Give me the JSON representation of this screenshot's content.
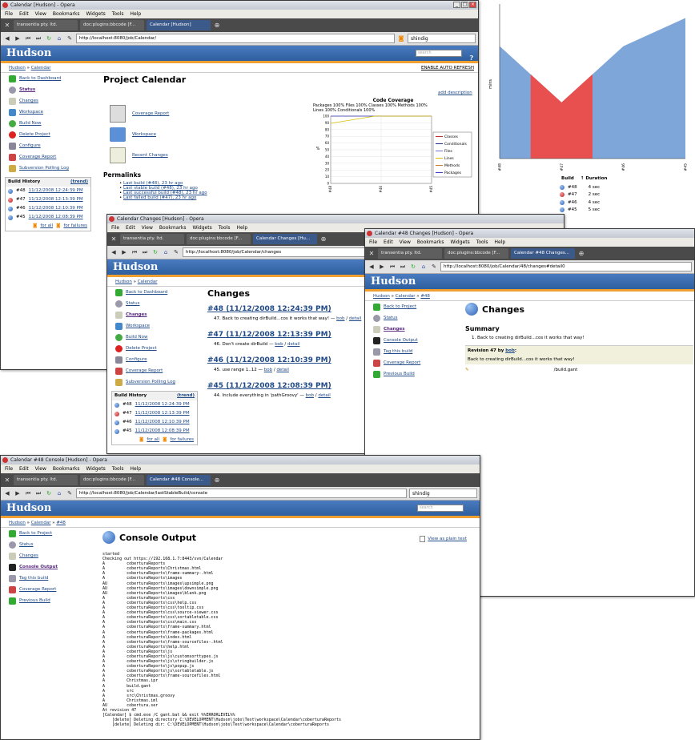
{
  "browser": {
    "menu": [
      "File",
      "Edit",
      "View",
      "Bookmarks",
      "Widgets",
      "Tools",
      "Help"
    ],
    "tab1": "transentia pty. ltd.",
    "tab2": "doc:plugins:bbcode [F...",
    "search": "shindig"
  },
  "hudson": {
    "logo": "Hudson",
    "search_placeholder": "search"
  },
  "w1": {
    "title": "Calendar [Hudson] - Opera",
    "tab": "Calendar [Hudson]",
    "url": "http://localhost:8080/job/Calendar/",
    "bc1": "Hudson",
    "bc2": "Calendar",
    "auto": "ENABLE AUTO REFRESH",
    "side": [
      "Back to Dashboard",
      "Status",
      "Changes",
      "Workspace",
      "Build Now",
      "Delete Project",
      "Configure",
      "Coverage Report",
      "Subversion Polling Log"
    ],
    "history": {
      "title": "Build History",
      "trend": "(trend)",
      "rows": [
        {
          "n": "#48",
          "d": "11/12/2008 12:24:39 PM"
        },
        {
          "n": "#47",
          "d": "11/12/2008 12:13:39 PM"
        },
        {
          "n": "#46",
          "d": "11/12/2008 12:10:39 PM"
        },
        {
          "n": "#45",
          "d": "11/12/2008 12:08:39 PM"
        }
      ],
      "all": "for all",
      "fail": "for failures"
    },
    "heading": "Project Calendar",
    "add_desc": "add description",
    "links": [
      "Coverage Report",
      "Workspace",
      "Recent Changes"
    ],
    "perma": {
      "title": "Permalinks",
      "items": [
        "Last build (#48), 23 hr ago",
        "Last stable build (#48), 23 hr ago",
        "Last successful build (#48), 23 hr ago",
        "Last failed build (#47), 23 hr ago"
      ]
    }
  },
  "cov": {
    "title": "Code Coverage",
    "l1": "Packages  100% Files  100% Classes  100% Methods  100%",
    "l2": "Lines  100% Conditionals  100%",
    "legend": [
      "Classes",
      "Conditionals",
      "Files",
      "Lines",
      "Methods",
      "Packages"
    ],
    "legend_colors": [
      "#c03030",
      "#203080",
      "#7070d0",
      "#d8c000",
      "#c08030",
      "#4040c0"
    ],
    "yticks": [
      "100",
      "90",
      "80",
      "70",
      "60",
      "50",
      "40",
      "30",
      "20",
      "10",
      "0"
    ],
    "xticks": [
      "#48",
      "#46",
      "#45"
    ],
    "ylabel": "%"
  },
  "chart_data": {
    "type": "area",
    "x": [
      "#48",
      "#47",
      "#46",
      "#45"
    ],
    "series": [
      {
        "values": [
          4,
          2,
          4,
          5
        ]
      }
    ],
    "ylabel": "mins",
    "colors": [
      "#7ea6d8",
      "#e85050"
    ]
  },
  "durations": {
    "h1": "Build",
    "h2": "↑ Duration",
    "rows": [
      {
        "n": "#48",
        "d": "4 sec"
      },
      {
        "n": "#47",
        "d": "2 sec"
      },
      {
        "n": "#46",
        "d": "4 sec"
      },
      {
        "n": "#45",
        "d": "5 sec"
      }
    ]
  },
  "w2": {
    "title": "Calendar Changes [Hudson] - Opera",
    "tab": "Calendar Changes [Hu...",
    "url": "http://localhost:8080/job/Calendar/changes",
    "heading": "Changes",
    "entries": [
      {
        "h": "#48 (11/12/2008 12:24:39 PM)",
        "t": "47. Back to creating dirBuild...cos it works that way! —",
        "u": "bob",
        "d": "detail"
      },
      {
        "h": "#47 (11/12/2008 12:13:39 PM)",
        "t": "46. Don't create dirBuild —",
        "u": "bob",
        "d": "detail"
      },
      {
        "h": "#46 (11/12/2008 12:10:39 PM)",
        "t": "45. use range 1..12 —",
        "u": "bob",
        "d": "detail"
      },
      {
        "h": "#45 (11/12/2008 12:08:39 PM)",
        "t": "44. Include everything in 'pathGroovy' —",
        "u": "bob",
        "d": "detail"
      }
    ]
  },
  "w3": {
    "title": "Calendar #48 Changes [Hudson] - Opera",
    "tab": "Calendar #48 Changes...",
    "url": "http://localhost:8080/job/Calendar/48/changes#detail0",
    "bc3": "#48",
    "side": [
      "Back to Project",
      "Status",
      "Changes",
      "Console Output",
      "Tag this build",
      "Coverage Report",
      "Previous Build"
    ],
    "heading": "Changes",
    "summary": "Summary",
    "item": "1.  Back to creating dirBuild...cos it works that way!",
    "rev": "Revision 47 by",
    "rev_user": "bob",
    "rev_msg": "Back to creating dirBuild...cos it works that way!",
    "file": "/build.gant"
  },
  "w4": {
    "title": "Calendar #48 Console [Hudson] - Opera",
    "tab": "Calendar #48 Console...",
    "url": "http://localhost:8080/job/Calendar/lastStableBuild/console",
    "heading": "Console Output",
    "plain": "View as plain text",
    "console": "started\nChecking out https://192.168.1.7:8443/svn/Calendar\nA         coberturaReports\nA         coberturaReports\\Christmas.html\nA         coberturaReports\\frame-summary-.html\nA         coberturaReports\\images\nAU        coberturaReports\\images\\upsimple.png\nAU        coberturaReports\\images\\downsimple.png\nAU        coberturaReports\\images\\blank.png\nA         coberturaReports\\css\nA         coberturaReports\\css\\help.css\nA         coberturaReports\\css\\tooltip.css\nA         coberturaReports\\css\\source-viewer.css\nA         coberturaReports\\css\\sortabletable.css\nA         coberturaReports\\css\\main.css\nA         coberturaReports\\frame-summary.html\nA         coberturaReports\\frame-packages.html\nA         coberturaReports\\index.html\nA         coberturaReports\\frame-sourcefiles-.html\nA         coberturaReports\\help.html\nA         coberturaReports\\js\nA         coberturaReports\\js\\customsorttypes.js\nA         coberturaReports\\js\\stringbuilder.js\nA         coberturaReports\\js\\popup.js\nA         coberturaReports\\js\\sortabletable.js\nA         coberturaReports\\frame-sourcefiles.html\nA         Christmas.ipr\nA         build.gant\nA         src\nA         src\\Christmas.groovy\nA         Christmas.iml\nAU        cobertura.ser\nAt revision 47\n[Calendar] $ cmd.exe /C gant.bat && exit %%ERRORLEVEL%%\n    [delete] Deleting directory C:\\DEVELOPMENT\\Hudson\\jobs\\Test\\workspace\\Calendar\\coberturaReports\n    [delete] Deleting dir: C:\\DEVELOPMENT\\Hudson\\jobs\\Test\\workspace\\Calendar\\coberturaReports"
  }
}
